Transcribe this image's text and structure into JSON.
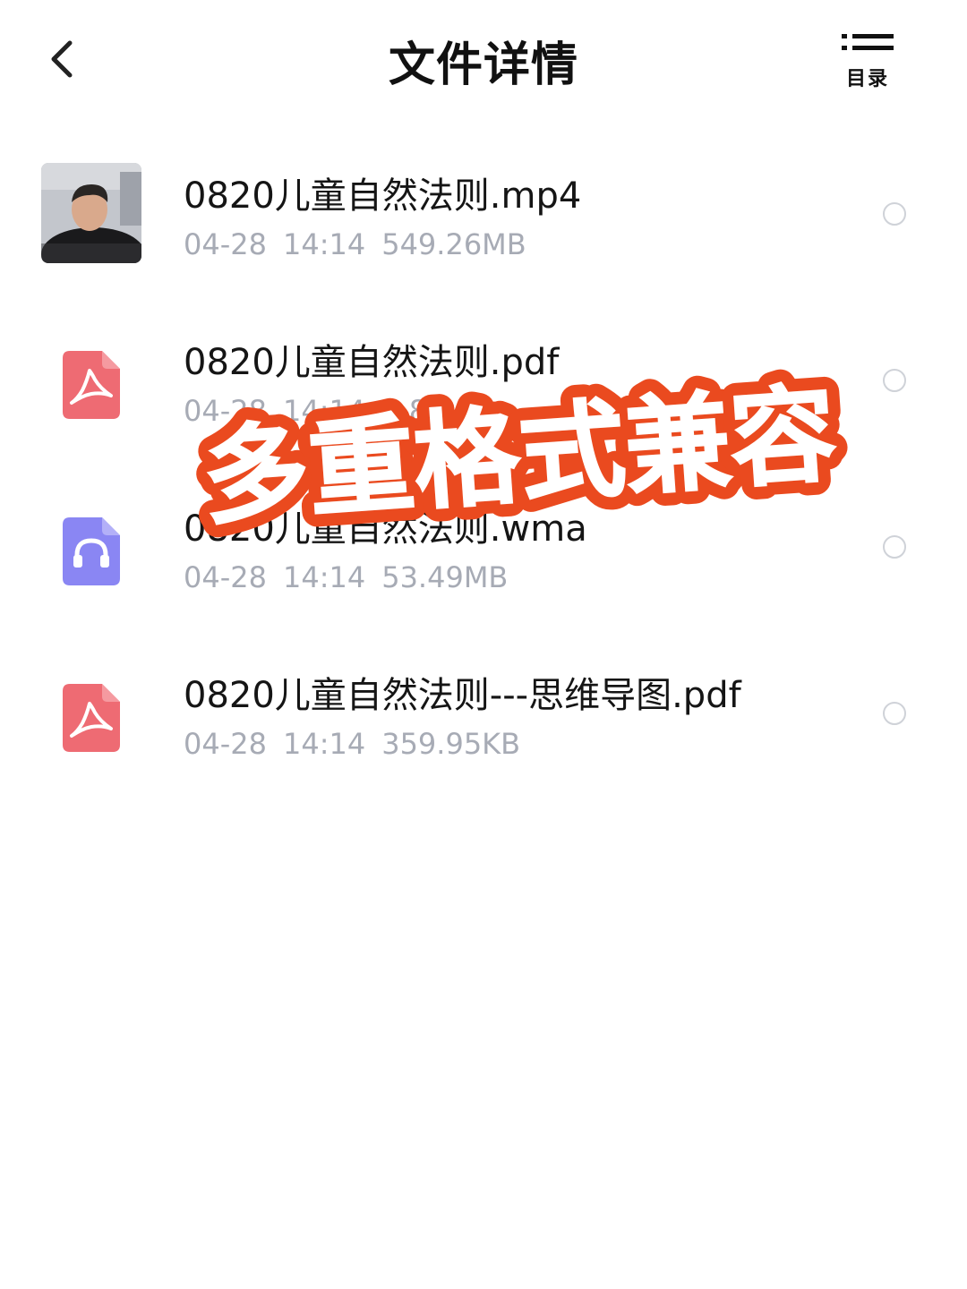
{
  "header": {
    "title": "文件详情",
    "toc_label": "目录"
  },
  "files": [
    {
      "name": "0820儿童自然法则.mp4",
      "date": "04-28",
      "time": "14:14",
      "size": "549.26MB",
      "icon": "video-thumbnail"
    },
    {
      "name": "0820儿童自然法则.pdf",
      "date": "04-28",
      "time": "14:14",
      "size": "5.8",
      "icon": "pdf-file-icon"
    },
    {
      "name": "0820儿童自然法则.wma",
      "date": "04-28",
      "time": "14:14",
      "size": "53.49MB",
      "icon": "audio-file-icon"
    },
    {
      "name": "0820儿童自然法则---思维导图.pdf",
      "date": "04-28",
      "time": "14:14",
      "size": "359.95KB",
      "icon": "pdf-file-icon"
    }
  ],
  "overlay": {
    "text": "多重格式兼容",
    "fill_color": "#ffffff",
    "stroke_color": "#ea4a1f"
  },
  "colors": {
    "pdf_icon": "#ee6b73",
    "audio_icon": "#8a86f3",
    "meta_text": "#a7abb5"
  }
}
